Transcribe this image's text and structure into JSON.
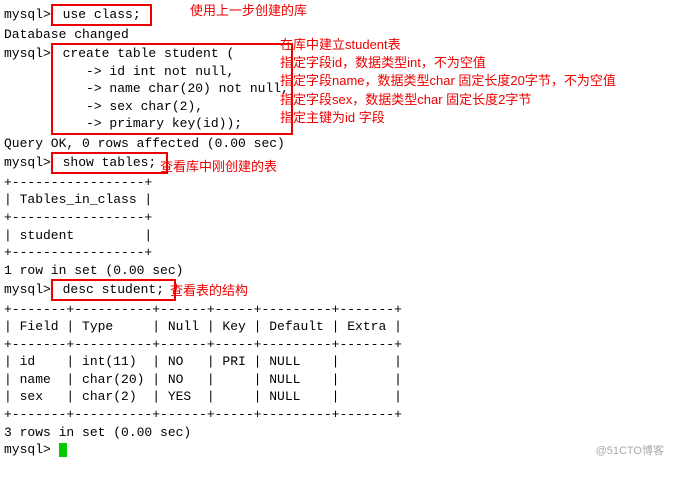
{
  "prompt": "mysql>",
  "cont": "    ->",
  "cmd": {
    "use_class": " use class; ",
    "create_table": " create table student (",
    "col_id": " id int not null,",
    "col_name": " name char(20) not null,",
    "col_sex": " sex char(2),",
    "col_pk": " primary key(id));",
    "show_tables": " show tables; ",
    "desc_student": " desc student; "
  },
  "out": {
    "db_changed": "Database changed",
    "query_ok": "Query OK, 0 rows affected (0.00 sec)",
    "empty_line": "",
    "tables_sep": "+-----------------+",
    "tables_header": "| Tables_in_class |",
    "tables_row": "| student         |",
    "rows_1": "1 row in set (0.00 sec)",
    "desc_sep": "+-------+----------+------+-----+---------+-------+",
    "desc_header": "| Field | Type     | Null | Key | Default | Extra |",
    "desc_row_id": "| id    | int(11)  | NO   | PRI | NULL    |       |",
    "desc_row_name": "| name  | char(20) | NO   |     | NULL    |       |",
    "desc_row_sex": "| sex   | char(2)  | YES  |     | NULL    |       |",
    "rows_3": "3 rows in set (0.00 sec)"
  },
  "ann": {
    "use_db": "使用上一步创建的库",
    "create_title": "在库中建立student表",
    "create_l1": "指定字段id，数据类型int，不为空值",
    "create_l2": "指定字段name，数据类型char 固定长度20字节，不为空值",
    "create_l3": "指定字段sex，数据类型char 固定长度2字节",
    "create_l4": "指定主键为id 字段",
    "show_tables": "查看库中刚创建的表",
    "desc": "查看表的结构"
  },
  "watermark": "@51CTO博客"
}
